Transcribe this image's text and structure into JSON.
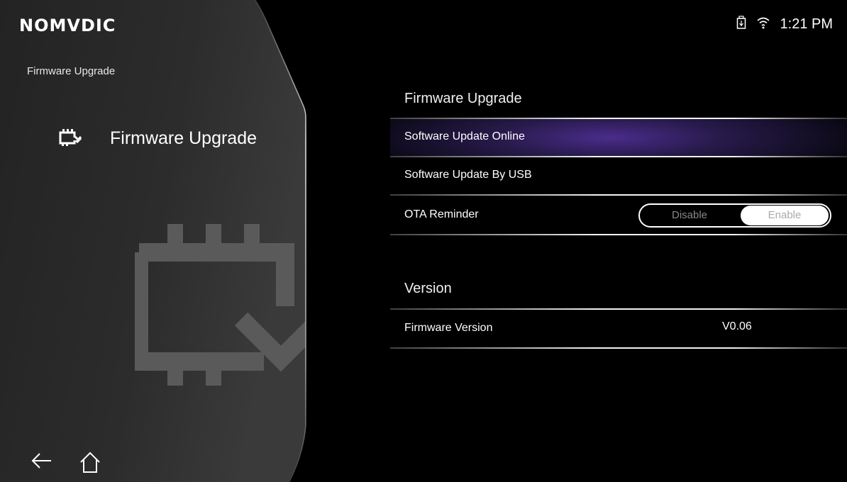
{
  "brand": {
    "logo_text": "NOMVDIC"
  },
  "status_bar": {
    "time": "1:21 PM",
    "icons": [
      "usb-storage-icon",
      "wifi-icon"
    ]
  },
  "left": {
    "breadcrumb": "Firmware Upgrade",
    "menu_item": {
      "label": "Firmware Upgrade",
      "icon": "firmware-upgrade-icon"
    },
    "nav": {
      "back_icon": "back-arrow-icon",
      "home_icon": "home-icon"
    }
  },
  "firmware_section": {
    "title": "Firmware Upgrade",
    "items": [
      {
        "label": "Software Update Online",
        "selected": true
      },
      {
        "label": "Software Update By USB",
        "selected": false
      }
    ],
    "ota": {
      "label": "OTA Reminder",
      "options": [
        "Disable",
        "Enable"
      ],
      "selected": "Enable"
    }
  },
  "version_section": {
    "title": "Version",
    "firmware_version_label": "Firmware Version",
    "firmware_version_value": "V0.06"
  },
  "colors": {
    "selected_row_accent": "#4b2c8c",
    "background": "#000000"
  }
}
